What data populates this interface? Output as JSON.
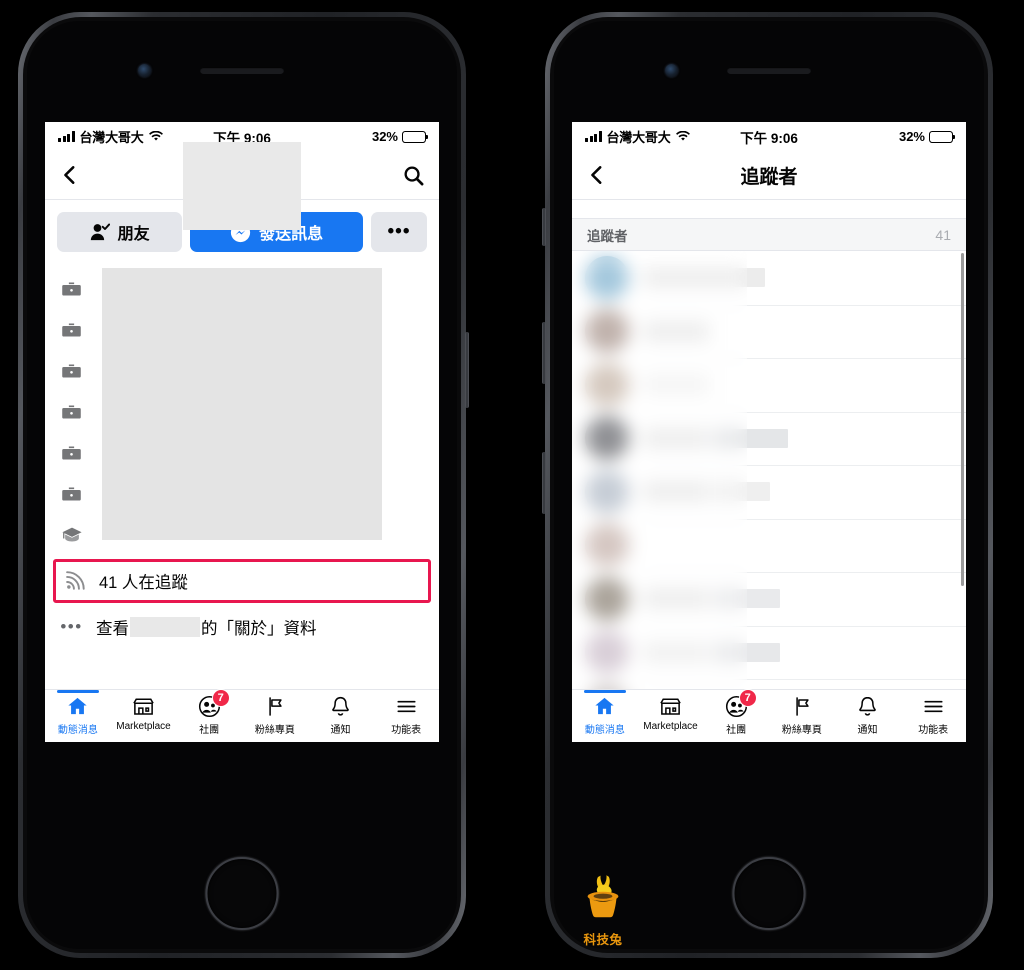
{
  "status_bar": {
    "carrier": "台灣大哥大",
    "time": "下午 9:06",
    "battery_percent": "32%",
    "signal_icon": "cellular-signal-icon",
    "wifi_icon": "wifi-icon",
    "battery_icon": "battery-icon"
  },
  "profile_screen": {
    "back_icon": "back-chevron-icon",
    "search_icon": "search-icon",
    "name_redacted": "",
    "buttons": {
      "friend_label": "朋友",
      "friend_icon": "person-check-icon",
      "message_label": "發送訊息",
      "message_icon": "messenger-icon",
      "more_label": "•••",
      "more_icon": "ellipsis-icon"
    },
    "info_rows": [
      {
        "icon": "briefcase-icon",
        "text": ""
      },
      {
        "icon": "briefcase-icon",
        "text": ""
      },
      {
        "icon": "briefcase-icon",
        "text": ""
      },
      {
        "icon": "briefcase-icon",
        "text": ""
      },
      {
        "icon": "briefcase-icon",
        "text": ""
      },
      {
        "icon": "briefcase-icon",
        "text": ""
      },
      {
        "icon": "graduation-cap-icon",
        "text": ""
      }
    ],
    "followers_row": {
      "icon": "rss-followers-icon",
      "label": "41 人在追蹤",
      "highlight_color": "#e8174f"
    },
    "about_row": {
      "icon": "ellipsis-icon",
      "prefix": "查看",
      "suffix": "的「關於」資料"
    }
  },
  "followers_screen": {
    "back_icon": "back-chevron-icon",
    "title": "追蹤者",
    "section": {
      "title": "追蹤者",
      "count": "41"
    },
    "rows": [
      {
        "avatar_color": "#a4c8dd",
        "name_width": 122,
        "second_width": 0
      },
      {
        "avatar_color": "#c0b2ac",
        "name_width": 66,
        "second_width": 0
      },
      {
        "avatar_color": "#d5c9bf",
        "name_width": 66,
        "second_width": 0
      },
      {
        "avatar_color": "#8f9094",
        "name_width": 66,
        "second_width": 74
      },
      {
        "avatar_color": "#c6cdd6",
        "name_width": 66,
        "second_width": 56
      },
      {
        "avatar_color": "#d5c7c2",
        "name_width": 0,
        "second_width": 0
      },
      {
        "avatar_color": "#aba49b",
        "name_width": 66,
        "second_width": 66
      },
      {
        "avatar_color": "#d9cfd8",
        "name_width": 66,
        "second_width": 66
      },
      {
        "avatar_color": "#d2cccb",
        "name_width": 0,
        "second_width": 0
      },
      {
        "avatar_color": "#7a6254",
        "name_width": 66,
        "second_width": 0
      }
    ],
    "scrollbar": "vertical-scrollbar"
  },
  "tab_bar": {
    "items": [
      {
        "label": "動態消息",
        "icon": "home-icon",
        "active": true,
        "badge": ""
      },
      {
        "label": "Marketplace",
        "icon": "marketplace-icon",
        "active": false,
        "badge": ""
      },
      {
        "label": "社團",
        "icon": "groups-icon",
        "active": false,
        "badge": "7"
      },
      {
        "label": "粉絲專頁",
        "icon": "pages-flag-icon",
        "active": false,
        "badge": ""
      },
      {
        "label": "通知",
        "icon": "bell-icon",
        "active": false,
        "badge": ""
      },
      {
        "label": "功能表",
        "icon": "menu-hamburger-icon",
        "active": false,
        "badge": ""
      }
    ],
    "accent_color": "#1877f2",
    "badge_color": "#f02849"
  },
  "watermark": {
    "label": "科技兔",
    "icon": "rabbit-in-hat-icon",
    "color": "#e8960e"
  }
}
